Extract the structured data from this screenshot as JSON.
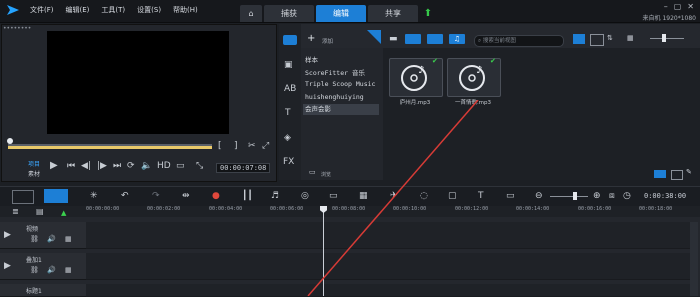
{
  "menu": [
    "文件(F)",
    "编辑(E)",
    "工具(T)",
    "设置(S)",
    "帮助(H)"
  ],
  "tabs": {
    "home": "⌂",
    "capture": "捕获",
    "edit": "编辑",
    "share": "共享"
  },
  "status": {
    "resolution": "1920*1080",
    "project_label": "来自机"
  },
  "preview": {
    "project_label": "项目",
    "clip_label": "素材",
    "timecode": "00:00:07:08"
  },
  "library": {
    "add_label": "添加",
    "items": [
      "样本",
      "ScoreFitter 音乐",
      "Triple Scoop Music",
      "huishenghuiying",
      "会声会影"
    ],
    "selected_index": 4,
    "browse_label": "浏览",
    "search_placeholder": "搜索当前视图"
  },
  "media": [
    {
      "name": "庐州月.mp3"
    },
    {
      "name": "一首情歌.mp3"
    }
  ],
  "timeline": {
    "timecode": "0:00:38:00",
    "ruler_ticks": [
      "00:00:00:00",
      "00:00:02:00",
      "00:00:04:00",
      "00:00:06:00",
      "00:00:08:00",
      "00:00:10:00",
      "00:00:12:00",
      "00:00:14:00",
      "00:00:16:00",
      "00:00:18:00"
    ],
    "tracks": [
      "视频",
      "叠加1",
      "标题1"
    ]
  },
  "colors": {
    "accent": "#1d7fd6",
    "cursor": "#d63b36"
  }
}
